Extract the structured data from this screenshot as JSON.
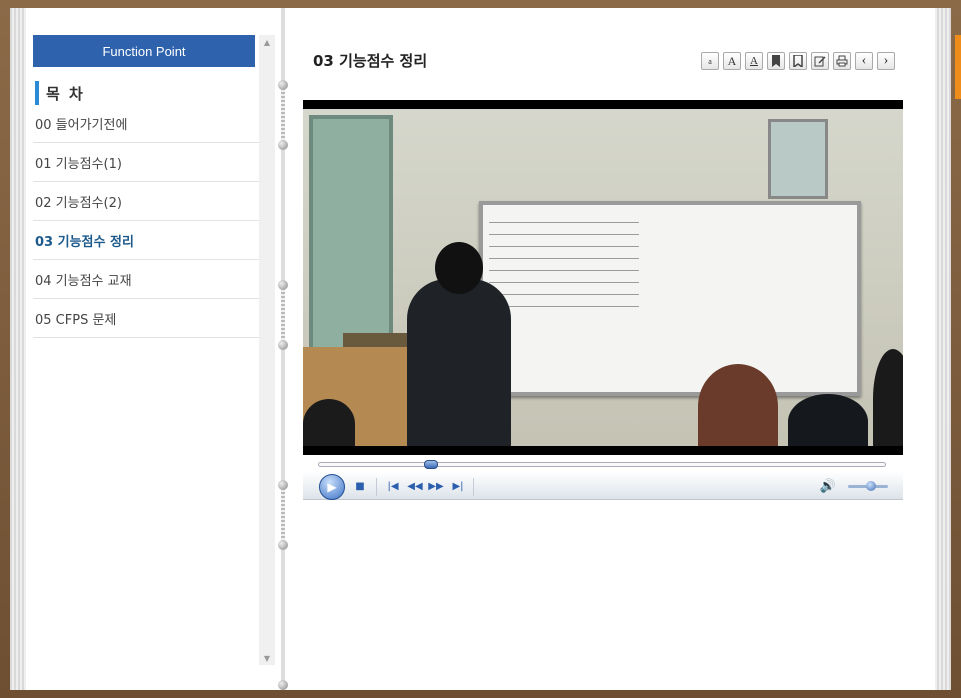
{
  "sidebar": {
    "header": "Function Point",
    "toc_title": "목 차",
    "items": [
      {
        "label": "00 들어가기전에"
      },
      {
        "label": "01 기능점수(1)"
      },
      {
        "label": "02 기능점수(2)"
      },
      {
        "label": "03 기능점수 정리",
        "active": true
      },
      {
        "label": "04 기능점수 교재"
      },
      {
        "label": "05 CFPS 문제"
      }
    ]
  },
  "main": {
    "title": "03 기능점수 정리",
    "toolbar": {
      "font_smaller": "a",
      "font_larger": "A",
      "font_default": "A",
      "bookmark": "bookmark-icon",
      "bookmark_list": "bookmark-list-icon",
      "memo": "edit-icon",
      "print": "print-icon",
      "prev": "‹",
      "next": "›"
    }
  },
  "player": {
    "progress": 0.19,
    "volume": 0.6,
    "icons": [
      "play-icon",
      "stop-icon",
      "skip-back-icon",
      "rewind-icon",
      "fast-forward-icon",
      "skip-forward-icon",
      "volume-icon"
    ]
  },
  "colors": {
    "header_blue": "#2e62ad",
    "active_item": "#1d5a8c",
    "toc_bar": "#2a8ad6",
    "accent_orange": "#f08c1a",
    "frame_brown": "#7a5a3a"
  }
}
